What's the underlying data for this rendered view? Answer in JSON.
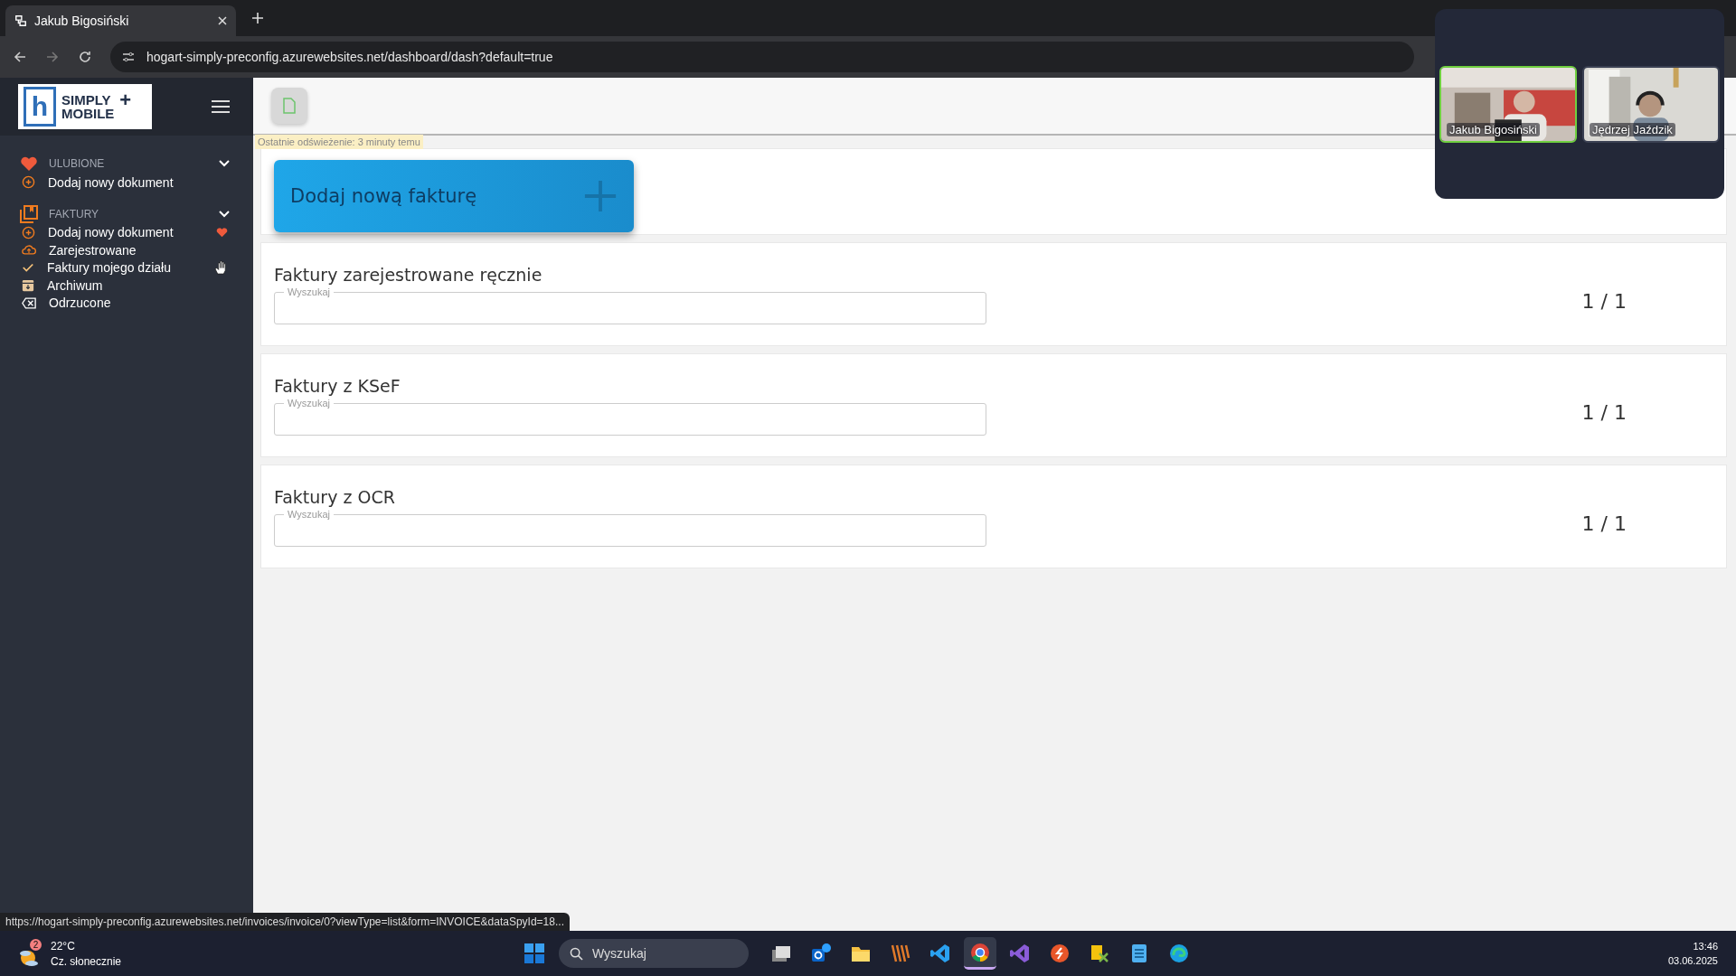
{
  "browser": {
    "tab": {
      "title": "Jakub Bigosiński"
    },
    "address": "hogart-simply-preconfig.azurewebsites.net/dashboard/dash?default=true",
    "status_link": "https://hogart-simply-preconfig.azurewebsites.net/invoices/invoice/0?viewType=list&form=INVOICE&dataSpyId=18..."
  },
  "sidebar": {
    "logo": {
      "letter": "h",
      "line_1": "SIMPLY",
      "line_2": "MOBILE",
      "mark": "+"
    },
    "sections": [
      {
        "title": "ULUBIONE",
        "kind": "heart",
        "expanded": true,
        "items": [
          {
            "label": "Dodaj nowy dokument",
            "kind": "add",
            "favorite": false
          }
        ]
      },
      {
        "title": "FAKTURY",
        "kind": "library",
        "expanded": true,
        "items": [
          {
            "label": "Dodaj nowy dokument",
            "kind": "add",
            "favorite": true
          },
          {
            "label": "Zarejestrowane",
            "kind": "cloud",
            "favorite": false
          },
          {
            "label": "Faktury mojego działu",
            "kind": "check",
            "favorite": false
          },
          {
            "label": "Archiwum",
            "kind": "archive",
            "favorite": false
          },
          {
            "label": "Odrzucone",
            "kind": "reject",
            "favorite": false
          }
        ]
      }
    ]
  },
  "main": {
    "refresh_note": "Ostatnie odświeżenie: 3 minuty temu",
    "add_button": {
      "label": "Dodaj nową fakturę"
    },
    "panels": [
      {
        "title": "Faktury zarejestrowane ręcznie",
        "search": {
          "placeholder": "Wyszukaj"
        },
        "count": "1 / 1"
      },
      {
        "title": "Faktury z KSeF",
        "search": {
          "placeholder": "Wyszukaj"
        },
        "count": "1 / 1"
      },
      {
        "title": "Faktury z OCR",
        "search": {
          "placeholder": "Wyszukaj"
        },
        "count": "1 / 1"
      }
    ]
  },
  "meeting": {
    "participants": [
      {
        "name": "Jakub Bigosiński",
        "speaking": true
      },
      {
        "name": "Jędrzej Jaździk",
        "speaking": false
      }
    ]
  },
  "taskbar": {
    "weather": {
      "badge": "2",
      "temperature": "22°C",
      "condition": "Cz. słonecznie"
    },
    "search": {
      "placeholder": "Wyszukaj"
    },
    "apps": [
      {
        "kind": "taskview",
        "active": false
      },
      {
        "kind": "mail",
        "active": false
      },
      {
        "kind": "folder",
        "active": false
      },
      {
        "kind": "stripes",
        "active": false
      },
      {
        "kind": "code",
        "active": false
      },
      {
        "kind": "browser",
        "active": true
      },
      {
        "kind": "studio",
        "active": false
      },
      {
        "kind": "remote",
        "active": false
      },
      {
        "kind": "tools",
        "active": false
      },
      {
        "kind": "notepad",
        "active": false
      },
      {
        "kind": "edge",
        "active": false
      }
    ],
    "time": "13:46",
    "date": "03.06.2025"
  }
}
